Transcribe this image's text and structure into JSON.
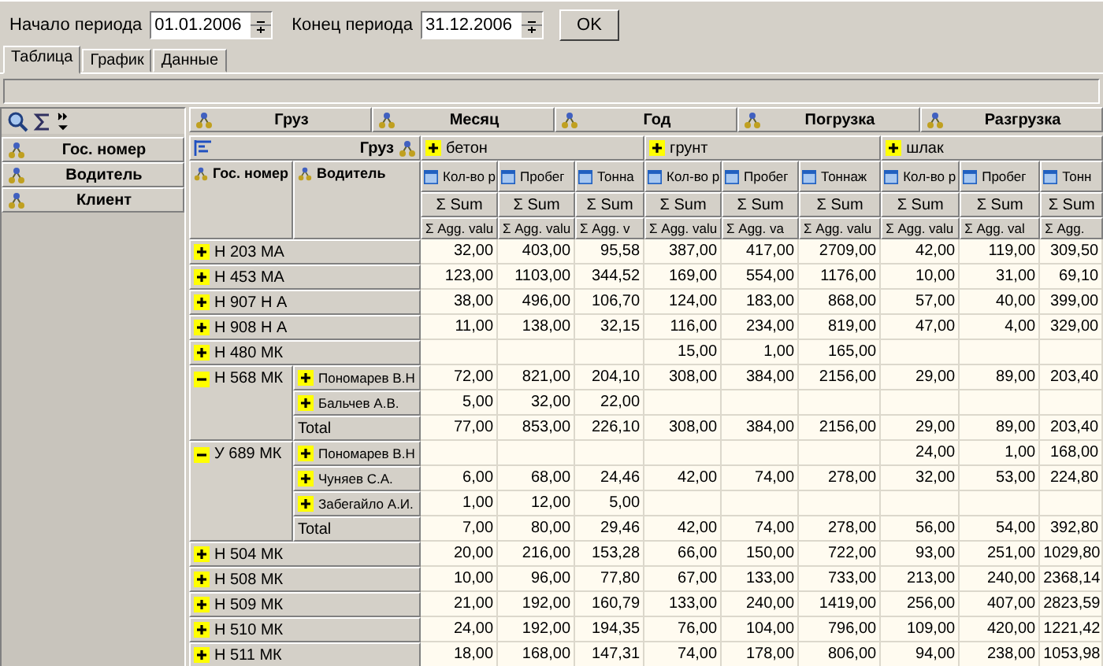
{
  "filter": {
    "start_label": "Начало периода",
    "start_value": "01.01.2006",
    "end_label": "Конец периода",
    "end_value": "31.12.2006",
    "ok": "OK"
  },
  "tabs": [
    {
      "label": "Таблица",
      "selected": true
    },
    {
      "label": "График",
      "selected": false
    },
    {
      "label": "Данные",
      "selected": false
    }
  ],
  "row_fields": [
    "Гос. номер",
    "Водитель",
    "Клиент"
  ],
  "column_fields": [
    "Груз",
    "Месяц",
    "Год",
    "Погрузка",
    "Разгрузка"
  ],
  "pivot": {
    "column_field": "Груз",
    "row_headers": [
      "Гос. номер",
      "Водитель"
    ],
    "groups": [
      {
        "label": "бетон",
        "measures": [
          {
            "label": "Кол-во р",
            "sum": "Σ Sum",
            "agg": "Σ Agg. valu"
          },
          {
            "label": "Пробег",
            "sum": "Σ Sum",
            "agg": "Σ Agg. valu"
          },
          {
            "label": "Тонна",
            "sum": "Σ Sum",
            "agg": "Σ Agg. v"
          }
        ]
      },
      {
        "label": "грунт",
        "measures": [
          {
            "label": "Кол-во р",
            "sum": "Σ Sum",
            "agg": "Σ Agg. valu"
          },
          {
            "label": "Пробег",
            "sum": "Σ Sum",
            "agg": "Σ Agg. va"
          },
          {
            "label": "Тоннаж",
            "sum": "Σ Sum",
            "agg": "Σ Agg. valu"
          }
        ]
      },
      {
        "label": "шлак",
        "measures": [
          {
            "label": "Кол-во р",
            "sum": "Σ Sum",
            "agg": "Σ Agg. valu"
          },
          {
            "label": "Пробег",
            "sum": "Σ Sum",
            "agg": "Σ Agg. val"
          },
          {
            "label": "Тонн",
            "sum": "Σ Sum",
            "agg": "Σ Agg."
          }
        ]
      }
    ],
    "rows": [
      {
        "plate": "Н 203 МА",
        "expanded": false,
        "values": {
          "col_1": "32,00",
          "col_2": "403,00",
          "col_3": "95,58",
          "col_4": "387,00",
          "col_5": "417,00",
          "col_6": "2709,00",
          "col_7": "42,00",
          "col_8": "119,00",
          "col_9": "309,50"
        }
      },
      {
        "plate": "Н 453 МА",
        "expanded": false,
        "values": {
          "col_1": "123,00",
          "col_2": "1103,00",
          "col_3": "344,52",
          "col_4": "169,00",
          "col_5": "554,00",
          "col_6": "1176,00",
          "col_7": "10,00",
          "col_8": "31,00",
          "col_9": "69,10"
        }
      },
      {
        "plate": "Н 907 Н А",
        "expanded": false,
        "values": {
          "col_1": "38,00",
          "col_2": "496,00",
          "col_3": "106,70",
          "col_4": "124,00",
          "col_5": "183,00",
          "col_6": "868,00",
          "col_7": "57,00",
          "col_8": "40,00",
          "col_9": "399,00"
        }
      },
      {
        "plate": "Н 908 Н А",
        "expanded": false,
        "values": {
          "col_1": "11,00",
          "col_2": "138,00",
          "col_3": "32,15",
          "col_4": "116,00",
          "col_5": "234,00",
          "col_6": "819,00",
          "col_7": "47,00",
          "col_8": "4,00",
          "col_9": "329,00"
        }
      },
      {
        "plate": "Н 480 МК",
        "expanded": false,
        "values": {
          "col_4": "15,00",
          "col_5": "1,00",
          "col_6": "165,00"
        }
      },
      {
        "plate": "Н 568  МК",
        "expanded": true,
        "drivers": [
          {
            "name": "Пономарев В.Н",
            "values": {
              "col_1": "72,00",
              "col_2": "821,00",
              "col_3": "204,10",
              "col_4": "308,00",
              "col_5": "384,00",
              "col_6": "2156,00",
              "col_7": "29,00",
              "col_8": "89,00",
              "col_9": "203,40"
            }
          },
          {
            "name": "Бальчев А.В.",
            "values": {
              "col_1": "5,00",
              "col_2": "32,00",
              "col_3": "22,00"
            }
          }
        ],
        "total": {
          "label": "Total",
          "values": {
            "col_1": "77,00",
            "col_2": "853,00",
            "col_3": "226,10",
            "col_4": "308,00",
            "col_5": "384,00",
            "col_6": "2156,00",
            "col_7": "29,00",
            "col_8": "89,00",
            "col_9": "203,40"
          }
        }
      },
      {
        "plate": "У 689 МК",
        "expanded": true,
        "drivers": [
          {
            "name": "Пономарев В.Н",
            "values": {
              "col_7": "24,00",
              "col_8": "1,00",
              "col_9": "168,00"
            }
          },
          {
            "name": "Чуняев С.А.",
            "values": {
              "col_1": "6,00",
              "col_2": "68,00",
              "col_3": "24,46",
              "col_4": "42,00",
              "col_5": "74,00",
              "col_6": "278,00",
              "col_7": "32,00",
              "col_8": "53,00",
              "col_9": "224,80"
            }
          },
          {
            "name": "Забегайло А.И.",
            "values": {
              "col_1": "1,00",
              "col_2": "12,00",
              "col_3": "5,00"
            }
          }
        ],
        "total": {
          "label": "Total",
          "values": {
            "col_1": "7,00",
            "col_2": "80,00",
            "col_3": "29,46",
            "col_4": "42,00",
            "col_5": "74,00",
            "col_6": "278,00",
            "col_7": "56,00",
            "col_8": "54,00",
            "col_9": "392,80"
          }
        }
      },
      {
        "plate": "Н 504  МК",
        "expanded": false,
        "values": {
          "col_1": "20,00",
          "col_2": "216,00",
          "col_3": "153,28",
          "col_4": "66,00",
          "col_5": "150,00",
          "col_6": "722,00",
          "col_7": "93,00",
          "col_8": "251,00",
          "col_9": "1029,80"
        }
      },
      {
        "plate": "Н 508 МК",
        "expanded": false,
        "values": {
          "col_1": "10,00",
          "col_2": "96,00",
          "col_3": "77,80",
          "col_4": "67,00",
          "col_5": "133,00",
          "col_6": "733,00",
          "col_7": "213,00",
          "col_8": "240,00",
          "col_9": "2368,14"
        }
      },
      {
        "plate": "Н 509  МК",
        "expanded": false,
        "values": {
          "col_1": "21,00",
          "col_2": "192,00",
          "col_3": "160,79",
          "col_4": "133,00",
          "col_5": "240,00",
          "col_6": "1419,00",
          "col_7": "256,00",
          "col_8": "407,00",
          "col_9": "2823,59"
        }
      },
      {
        "plate": "Н 510  МК",
        "expanded": false,
        "values": {
          "col_1": "24,00",
          "col_2": "192,00",
          "col_3": "194,35",
          "col_4": "76,00",
          "col_5": "104,00",
          "col_6": "796,00",
          "col_7": "109,00",
          "col_8": "420,00",
          "col_9": "1221,42"
        }
      },
      {
        "plate": "Н 511  МК",
        "expanded": false,
        "values": {
          "col_1": "18,00",
          "col_2": "168,00",
          "col_3": "147,31",
          "col_4": "74,00",
          "col_5": "178,00",
          "col_6": "806,00",
          "col_7": "94,00",
          "col_8": "238,00",
          "col_9": "1053,98"
        }
      }
    ]
  }
}
